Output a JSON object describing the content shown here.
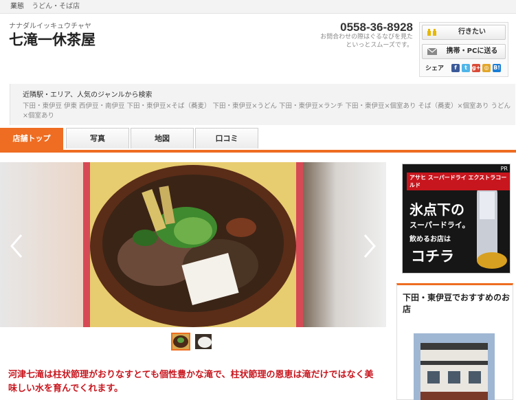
{
  "topbar": {
    "category_label": "業態",
    "category_value": "うどん・そば店"
  },
  "shop": {
    "furigana": "ナナダルイッキュウチャヤ",
    "name": "七滝一休茶屋"
  },
  "contact": {
    "phone": "0558-36-8928",
    "note": "お問合わせの際はぐるなびを見たといっとスムーズです。"
  },
  "actions": {
    "want_to_go": "行きたい",
    "send_to_mobile": "携帯・PCに送る",
    "share_label": "シェア",
    "share_icons": [
      "f",
      "t",
      "g+",
      "◎",
      "B!"
    ]
  },
  "search": {
    "title": "近隣駅・エリア、人気のジャンルから検索",
    "links": "下田・東伊豆 伊東 西伊豆・南伊豆 下田・東伊豆×そば（蕎麦） 下田・東伊豆×うどん 下田・東伊豆×ランチ 下田・東伊豆×個室あり そば（蕎麦）×個室あり うどん×個室あり"
  },
  "tabs": [
    {
      "label": "店舗トップ",
      "active": true
    },
    {
      "label": "写真",
      "active": false
    },
    {
      "label": "地図",
      "active": false
    },
    {
      "label": "口コミ",
      "active": false
    }
  ],
  "gallery": {
    "thumbnail_count": 2,
    "selected": 0
  },
  "catch_copy": "河津七滝は柱状節理がおりなすとても個性豊かな滝で、柱状節理の恩恵は滝だけではなく美味しい水を育んでくれます。",
  "ad": {
    "pr": "PR",
    "brand": "アサヒ スーパードライ エクストラコールド",
    "headline": "氷点下の",
    "sub": "スーパードライ。",
    "sub2": "飲めるお店は",
    "cta": "コチラ"
  },
  "recommend": {
    "title": "下田・東伊豆でおすすめのお店"
  },
  "colors": {
    "accent": "#ee6d22",
    "catch_text": "#c8161e"
  }
}
